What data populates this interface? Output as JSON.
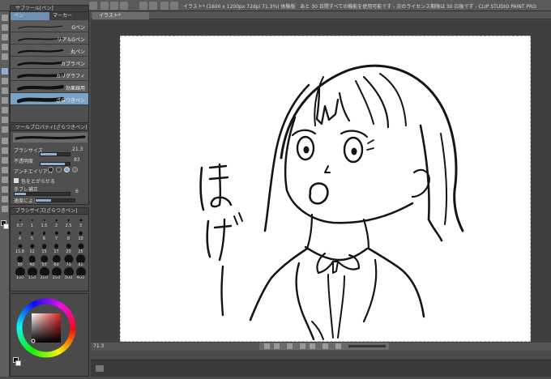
{
  "titlebar": {
    "title": "イラスト* (1600 x 1200px 72dpi 71.3%)  体験版　あと 30 日間すべての機能を使用可能です - 次のライセンス期限は 30 日後です - CLIP STUDIO PAINT PRO",
    "canvas_tab": "イラスト*"
  },
  "subtool": {
    "header": "サブツール[ペン]",
    "tabs": [
      "ペン",
      "マーカー"
    ],
    "brushes": [
      {
        "name": "Gペン",
        "selected": false
      },
      {
        "name": "リアルGペン",
        "selected": false
      },
      {
        "name": "丸ペン",
        "selected": false
      },
      {
        "name": "カブラペン",
        "selected": false
      },
      {
        "name": "カリグラフィ",
        "selected": false
      },
      {
        "name": "効果線用",
        "selected": false
      },
      {
        "name": "ざらつきペン",
        "selected": true
      }
    ]
  },
  "tool_property": {
    "header": "ツールプロパティ[ざらつきペン]",
    "brush_size_label": "ブラシサイズ",
    "brush_size_value": "21.3",
    "opacity_label": "不透明度",
    "opacity_value": "83",
    "antialias_label": "アンチエイリアス",
    "pressure_label": "色をとがらせる",
    "stabilization_label": "手ブレ補正",
    "stabilization_value": "6",
    "speed_label": "速度による"
  },
  "brush_size_panel": {
    "header": "ブラシサイズ[ざらつきペン]",
    "sizes": [
      "0.7",
      "1",
      "1.5",
      "2",
      "2.5",
      "3",
      "4",
      "5",
      "6",
      "7",
      "8",
      "10",
      "11.8",
      "12",
      "15",
      "17",
      "20",
      "25",
      "30",
      "40",
      "50",
      "60",
      "70",
      "80",
      "100",
      "150",
      "200",
      "250",
      "300",
      "400"
    ]
  },
  "canvas": {
    "zoom": "71.3"
  },
  "colors": {
    "accent": "#7aa3c9",
    "panel": "#4f4f4f",
    "paper": "#ffffff"
  }
}
